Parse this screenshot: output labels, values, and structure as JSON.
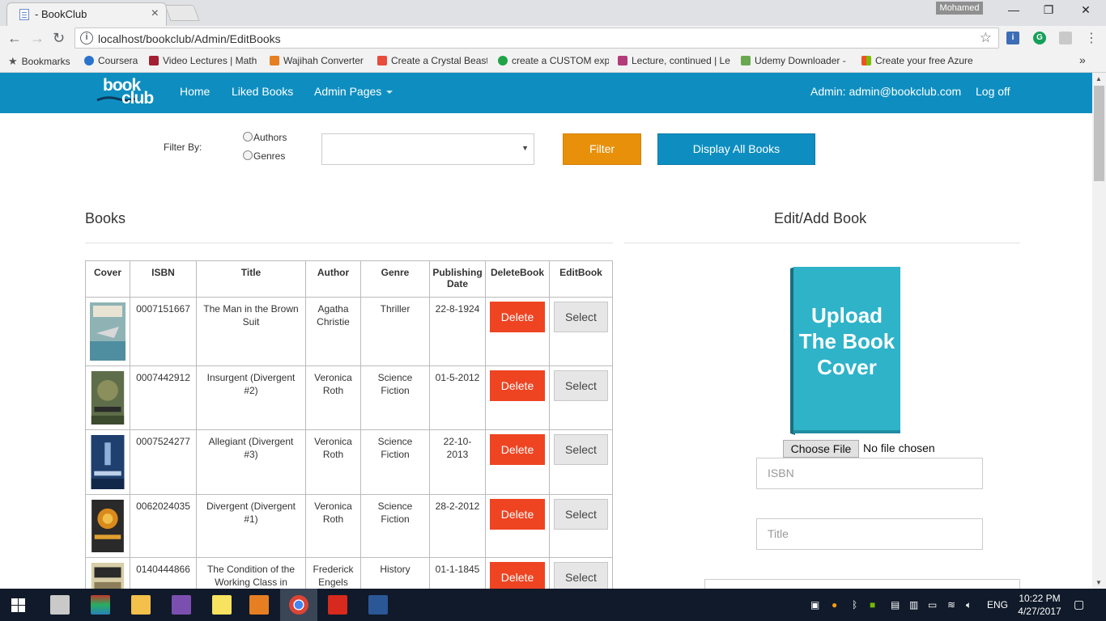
{
  "browser": {
    "tab_title": "- BookClub",
    "tab_close": "×",
    "profile_name": "Mohamed",
    "window_controls": {
      "minimize": "—",
      "restore": "❐",
      "close": "✕"
    },
    "url": "localhost/bookclub/Admin/EditBooks",
    "bookmarks": [
      {
        "label": "Bookmarks",
        "icon": "star-icon",
        "color": "#555555"
      },
      {
        "label": "Coursera",
        "icon": "coursera-icon",
        "color": "#2a73cc"
      },
      {
        "label": "Video Lectures | Math",
        "icon": "mit-ocw-icon",
        "color": "#a31f34"
      },
      {
        "label": "Wajihah Converter",
        "icon": "wajihah-icon",
        "color": "#e67e22"
      },
      {
        "label": "Create a Crystal Beast",
        "icon": "crystal-icon",
        "color": "#e74c3c"
      },
      {
        "label": "create a CUSTOM exp",
        "icon": "fi-icon",
        "color": "#1ea446"
      },
      {
        "label": "Lecture, continued | Le",
        "icon": "edx-icon",
        "color": "#b23b7a"
      },
      {
        "label": "Udemy Downloader -",
        "icon": "udemy-icon",
        "color": "#6aa84f"
      },
      {
        "label": "Create your free Azure",
        "icon": "microsoft-icon",
        "color": "#f25022"
      }
    ],
    "bookmarks_more": "»"
  },
  "nav": {
    "home": "Home",
    "liked_books": "Liked Books",
    "admin_pages": "Admin Pages",
    "admin_user": "Admin: admin@bookclub.com",
    "log_off": "Log off",
    "logo_top": "book",
    "logo_bottom": "club"
  },
  "filter": {
    "label": "Filter By:",
    "options": [
      "Authors",
      "Genres"
    ],
    "select_value": "",
    "filter_button": "Filter",
    "display_all_button": "Display All Books"
  },
  "books_panel": {
    "heading": "Books",
    "columns": [
      "Cover",
      "ISBN",
      "Title",
      "Author",
      "Genre",
      "Publishing Date",
      "DeleteBook",
      "EditBook"
    ],
    "rows": [
      {
        "isbn": "0007151667",
        "title": "The Man in the Brown Suit",
        "author": "Agatha Christie",
        "genre": "Thriller",
        "date": "22-8-1924",
        "cover_color": "#8fb3b5",
        "delete": "Delete",
        "select": "Select"
      },
      {
        "isbn": "0007442912",
        "title": "Insurgent (Divergent #2)",
        "author": "Veronica Roth",
        "genre": "Science Fiction",
        "date": "01-5-2012",
        "cover_color": "#5f6e4a",
        "delete": "Delete",
        "select": "Select"
      },
      {
        "isbn": "0007524277",
        "title": "Allegiant (Divergent #3)",
        "author": "Veronica Roth",
        "genre": "Science Fiction",
        "date": "22-10-2013",
        "cover_color": "#1f3f6e",
        "delete": "Delete",
        "select": "Select"
      },
      {
        "isbn": "0062024035",
        "title": "Divergent (Divergent #1)",
        "author": "Veronica Roth",
        "genre": "Science Fiction",
        "date": "28-2-2012",
        "cover_color": "#2a2a2a",
        "delete": "Delete",
        "select": "Select"
      },
      {
        "isbn": "0140444866",
        "title": "The Condition of the Working Class in England",
        "author": "Frederick Engels",
        "genre": "History",
        "date": "01-1-1845",
        "cover_color": "#d8cfa8",
        "delete": "Delete",
        "select": "Select"
      }
    ]
  },
  "edit_panel": {
    "heading": "Edit/Add Book",
    "upload_text": [
      "Upload",
      "The Book",
      "Cover"
    ],
    "upload_color": "#2eb3c9",
    "choose_file": "Choose File",
    "no_file": "No file chosen",
    "isbn_placeholder": "ISBN",
    "title_placeholder": "Title"
  },
  "taskbar": {
    "language": "ENG",
    "time": "10:22 PM",
    "date": "4/27/2017"
  }
}
